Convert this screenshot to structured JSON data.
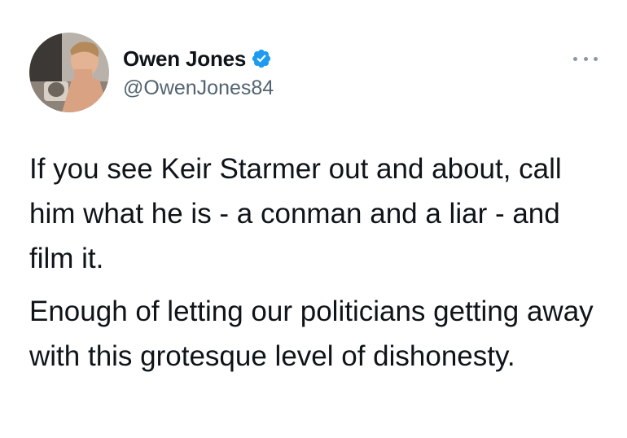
{
  "tweet": {
    "author": {
      "display_name": "Owen Jones",
      "handle": "@OwenJones84",
      "verified": true,
      "avatar_icon": "profile-photo",
      "verified_icon": "verified-badge-icon",
      "verified_color": "#1d9bf0"
    },
    "more_icon": "more-options-icon",
    "paragraphs": [
      "If you see Keir Starmer out and about, call him what he is - a conman and a liar - and film it.",
      "Enough of letting our politicians getting away with this grotesque level of dishonesty."
    ]
  },
  "colors": {
    "text": "#0f1419",
    "secondary_text": "#536471",
    "background": "#ffffff"
  }
}
